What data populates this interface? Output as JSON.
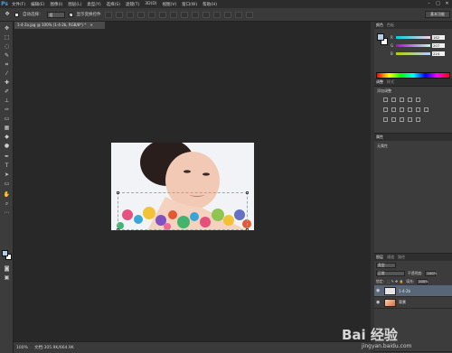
{
  "app": {
    "logo": "Ps"
  },
  "menu": [
    "文件(F)",
    "编辑(E)",
    "图像(I)",
    "图层(L)",
    "类型(Y)",
    "选择(S)",
    "滤镜(T)",
    "3D(D)",
    "视图(V)",
    "窗口(W)",
    "帮助(H)"
  ],
  "window_controls": [
    "–",
    "□",
    "✕"
  ],
  "options": {
    "auto_select_label": "自动选择：",
    "auto_select_value": "组",
    "transform_label": "显示变换控件",
    "workspace": "基本功能"
  },
  "document": {
    "tab_title": "1-4-2a.jpg @ 100% (1-4-2b, RGB/8*) *",
    "close": "×"
  },
  "status": {
    "zoom": "100%",
    "doc_info": "文档:305.9K/664.9K"
  },
  "color_panel": {
    "tabs": [
      "颜色",
      "色板"
    ],
    "sliders": [
      {
        "label": "R",
        "value": "182"
      },
      {
        "label": "G",
        "value": "207"
      },
      {
        "label": "B",
        "value": "224"
      }
    ]
  },
  "adjust_panel": {
    "tabs": [
      "调整",
      "样式"
    ],
    "title": "添加调整"
  },
  "props_panel": {
    "tab": "属性",
    "title": "无属性"
  },
  "layers_panel": {
    "tabs": [
      "图层",
      "通道",
      "路径"
    ],
    "kind": "类型",
    "blend": "正常",
    "opacity_label": "不透明度:",
    "opacity": "100%",
    "lock_label": "锁定:",
    "fill_label": "填充:",
    "fill": "100%",
    "layers": [
      {
        "name": "1-4-2b",
        "selected": true
      },
      {
        "name": "背景",
        "selected": false
      }
    ]
  },
  "watermark": {
    "brand": "Bai 经验",
    "url": "jingyan.baidu.com"
  },
  "colors": {
    "fg": "#b6cde8",
    "bg": "#ffffff",
    "selected_layer": "#596678"
  }
}
